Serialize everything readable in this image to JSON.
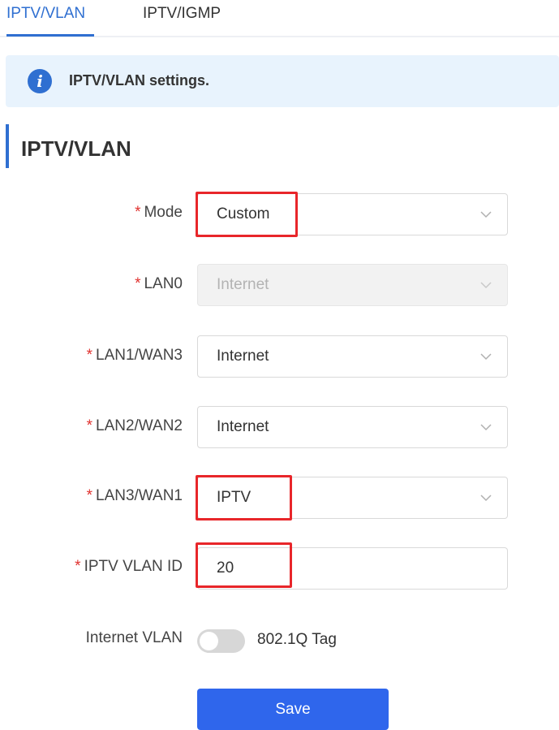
{
  "tabs": [
    {
      "label": "IPTV/VLAN",
      "active": true
    },
    {
      "label": "IPTV/IGMP",
      "active": false
    }
  ],
  "info": {
    "icon": "info-icon",
    "icon_glyph": "i",
    "text": "IPTV/VLAN settings."
  },
  "section": {
    "title": "IPTV/VLAN"
  },
  "form": {
    "required_mark": "*",
    "mode": {
      "label": "Mode",
      "value": "Custom",
      "highlighted": true
    },
    "lan0": {
      "label": "LAN0",
      "value": "Internet",
      "disabled": true
    },
    "lan1_wan3": {
      "label": "LAN1/WAN3",
      "value": "Internet"
    },
    "lan2_wan2": {
      "label": "LAN2/WAN2",
      "value": "Internet"
    },
    "lan3_wan1": {
      "label": "LAN3/WAN1",
      "value": "IPTV",
      "highlighted": true
    },
    "iptv_vlan_id": {
      "label": "IPTV VLAN ID",
      "value": "20",
      "highlighted": true
    },
    "internet_vlan": {
      "label": "Internet VLAN",
      "toggle_label": "802.1Q Tag",
      "enabled": false
    }
  },
  "buttons": {
    "save": "Save"
  },
  "colors": {
    "accent": "#2f6fd1",
    "button": "#2f66ec",
    "required": "#e0322f",
    "highlight": "#e8262a",
    "info_bg": "#e8f3fd"
  }
}
